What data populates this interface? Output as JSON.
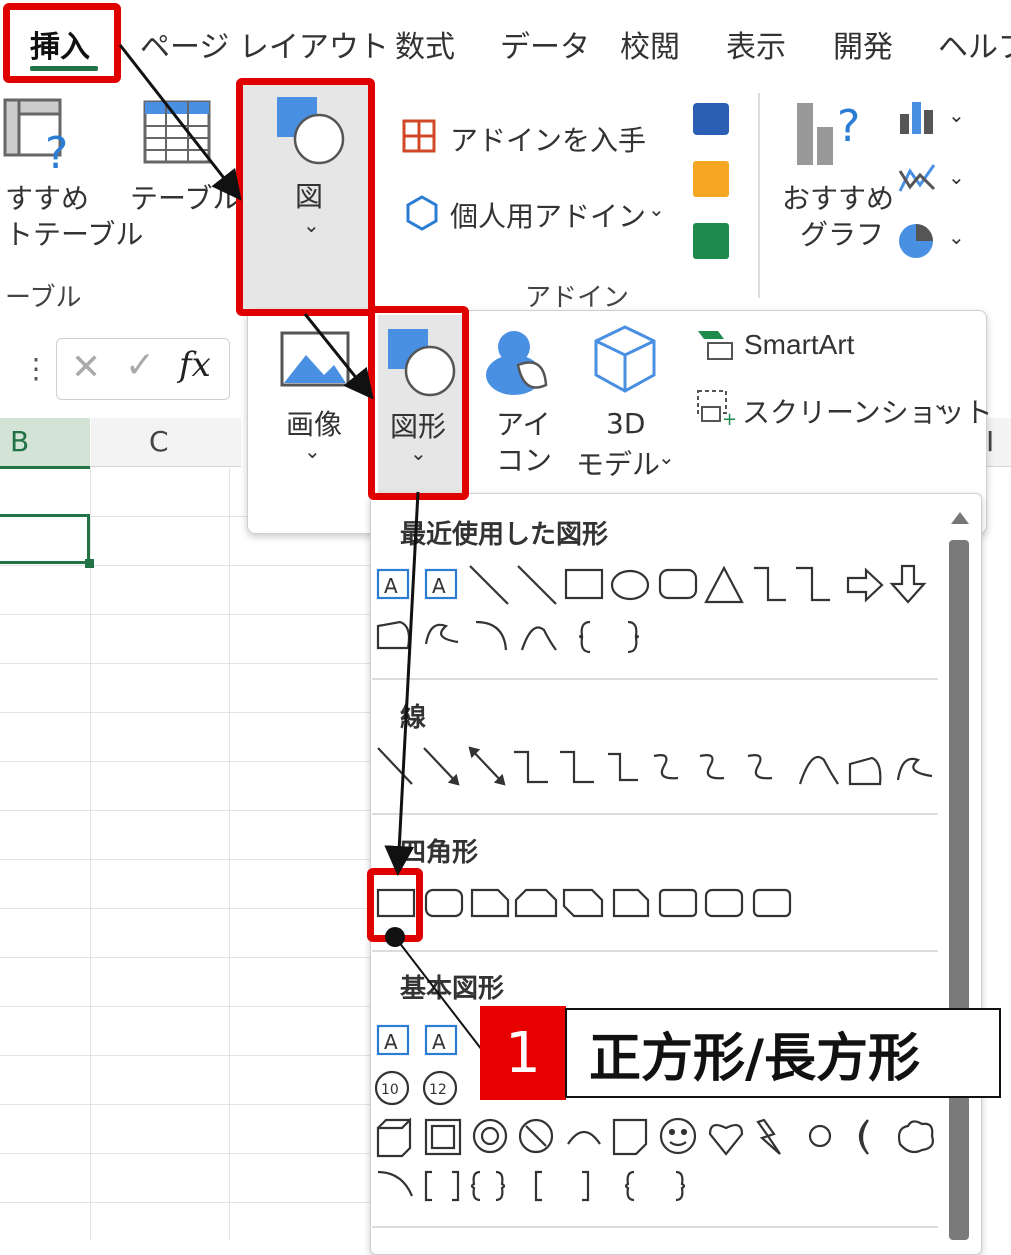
{
  "tabs": [
    "挿入",
    "ページ レイアウト",
    "数式",
    "データ",
    "校閲",
    "表示",
    "開発",
    "ヘルプ"
  ],
  "ribbon": {
    "pivot_line1": "すすめ",
    "pivot_line2": "トテーブル",
    "table_label": "テーブル",
    "group_table": "ーブル",
    "figure_label": "図",
    "addin_get": "アドインを入手",
    "addin_personal": "個人用アドイン",
    "group_addin": "アドイン",
    "rec_chart_line1": "おすすめ",
    "rec_chart_line2": "グラフ"
  },
  "formula_bar": {
    "fx": "fx"
  },
  "columns": [
    "B",
    "C",
    "I"
  ],
  "insert_panel": {
    "image_label": "画像",
    "shapes_label": "図形",
    "icon_line1": "アイ",
    "icon_line2": "コン",
    "model3d_line1": "3D",
    "model3d_line2": "モデル",
    "smartart": "SmartArt",
    "screenshot": "スクリーンショット"
  },
  "shapes_gallery": {
    "sections": [
      "最近使用した図形",
      "線",
      "四角形",
      "基本図形"
    ]
  },
  "callout": {
    "number": "1",
    "text": "正方形/長方形"
  },
  "colors": {
    "accent": "#217346",
    "highlight": "#e00000",
    "icon_blue": "#4a90e2"
  }
}
